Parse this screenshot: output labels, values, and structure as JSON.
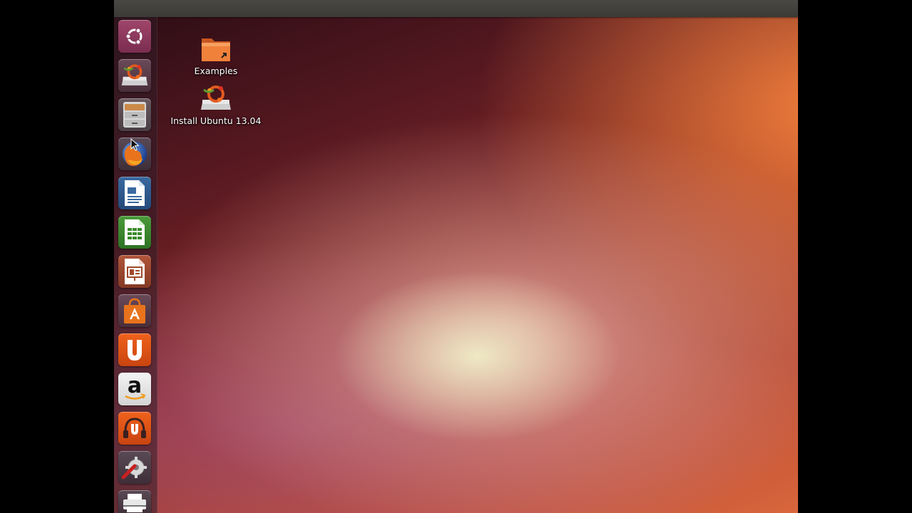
{
  "desktop": {
    "icons": [
      {
        "label": "Examples",
        "icon": "folder-link-icon"
      },
      {
        "label": "Install Ubuntu 13.04",
        "icon": "installer-icon"
      }
    ]
  },
  "launcher": {
    "items": [
      {
        "name": "dash",
        "icon": "ubuntu-logo-icon"
      },
      {
        "name": "installer",
        "icon": "installer-icon"
      },
      {
        "name": "files",
        "icon": "file-cabinet-icon"
      },
      {
        "name": "firefox",
        "icon": "firefox-icon"
      },
      {
        "name": "writer",
        "icon": "writer-document-icon"
      },
      {
        "name": "calc",
        "icon": "spreadsheet-icon"
      },
      {
        "name": "impress",
        "icon": "presentation-icon"
      },
      {
        "name": "software-center",
        "icon": "shopping-bag-icon"
      },
      {
        "name": "ubuntu-one",
        "icon": "ubuntu-one-icon"
      },
      {
        "name": "amazon",
        "icon": "amazon-icon",
        "glyph": "a"
      },
      {
        "name": "ubuntu-one-music",
        "icon": "headphones-icon"
      },
      {
        "name": "system-settings",
        "icon": "settings-wrench-icon"
      },
      {
        "name": "printer",
        "icon": "printer-icon"
      }
    ]
  },
  "colors": {
    "accent": "#dd4814",
    "panel": "#3c3b37"
  }
}
